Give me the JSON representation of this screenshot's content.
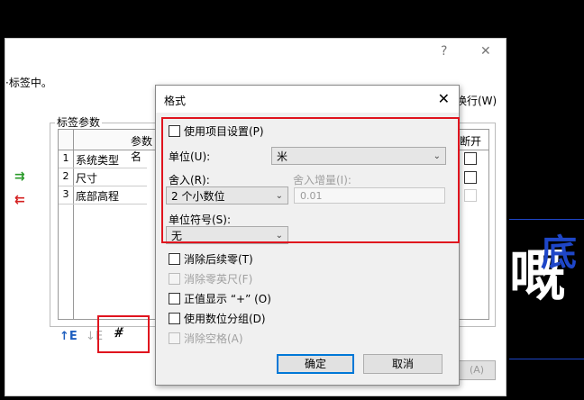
{
  "main_dialog": {
    "help_icon": "?",
    "close_icon": "✕",
    "header_text": "·标签中。",
    "wrap_label": "换行(W)",
    "group_title": "标签参数",
    "columns": {
      "param": "参数名",
      "break": "断开"
    },
    "rows": [
      {
        "num": "1",
        "name": "系统类型"
      },
      {
        "num": "2",
        "name": "尺寸"
      },
      {
        "num": "3",
        "name": "底部高程"
      }
    ],
    "ok_partial": "(A)"
  },
  "format_dialog": {
    "title": "格式",
    "use_project_settings": "使用项目设置(P)",
    "units_label": "单位(U):",
    "units_value": "米",
    "rounding_label": "舍入(R):",
    "rounding_value": "2 个小数位",
    "rounding_increment_label": "舍入增量(I):",
    "rounding_increment_value": "0.01",
    "unit_symbol_label": "单位符号(S):",
    "unit_symbol_value": "无",
    "suppress_trailing_zeros": "消除后续零(T)",
    "suppress_zero_feet": "消除零英尺(F)",
    "show_plus_sign": "正值显示 “+” (O)",
    "use_digit_grouping": "使用数位分组(D)",
    "suppress_spaces": "消除空格(A)",
    "ok_button": "确定",
    "cancel_button": "取消"
  },
  "colors": {
    "highlight": "#e0141e",
    "accent_blue": "#0078d7",
    "background": "#000000"
  }
}
